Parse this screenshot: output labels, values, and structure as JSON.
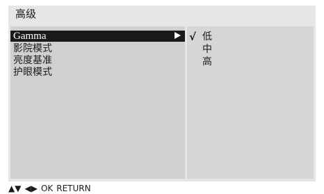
{
  "osd": {
    "title": "高级"
  },
  "menu": {
    "items": [
      {
        "label": "Gamma",
        "selected": true
      },
      {
        "label": "影院模式",
        "selected": false
      },
      {
        "label": "亮度基准",
        "selected": false
      },
      {
        "label": "护眼模式",
        "selected": false
      }
    ]
  },
  "options": {
    "check_mark": "√",
    "items": [
      {
        "label": "低",
        "checked": true
      },
      {
        "label": "中",
        "checked": false
      },
      {
        "label": "高",
        "checked": false
      }
    ]
  },
  "footer": {
    "up_down": "▲▼",
    "left_right": "◀▶",
    "ok": "OK",
    "return": "RETURN"
  },
  "colors": {
    "osd_background": "#e6e6e6",
    "panel": "#d0d0d0",
    "highlight": "#1a1a1a",
    "highlight_text": "#ffffff"
  }
}
